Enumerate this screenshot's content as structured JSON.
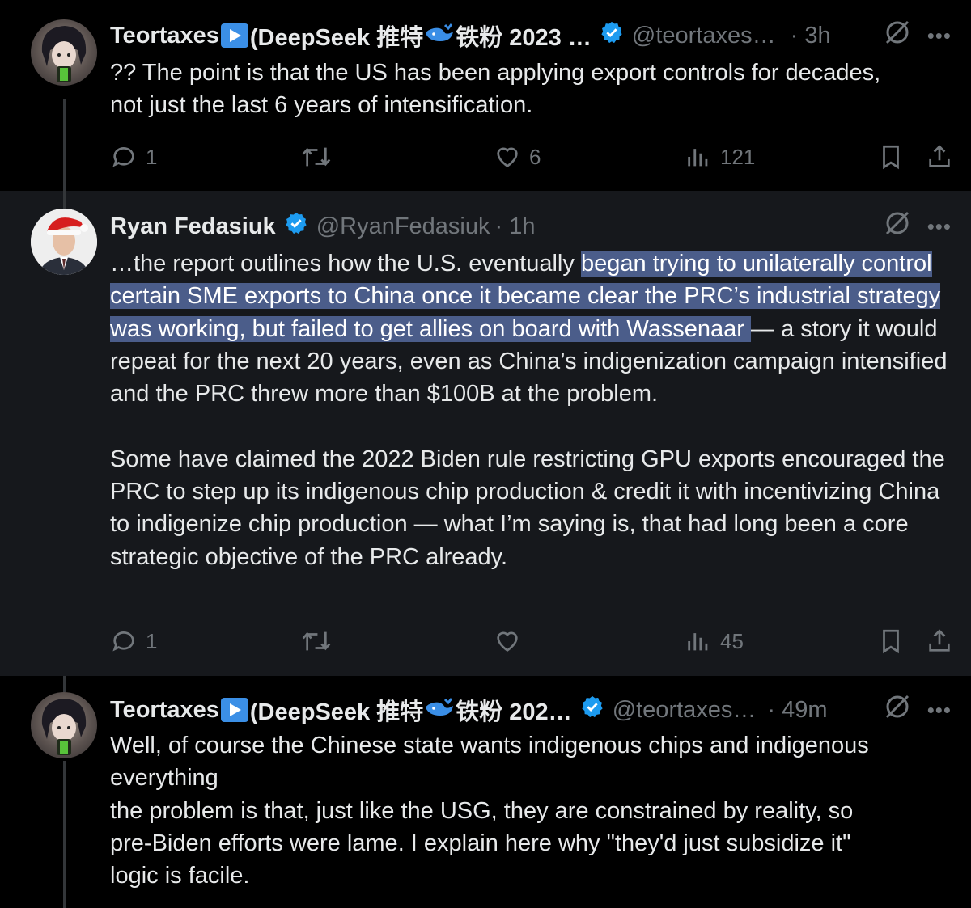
{
  "tweets": [
    {
      "author": "Teortaxes",
      "author_suffix_pre": "(DeepSeek 推特",
      "author_suffix_post": "铁粉 2023 …",
      "handle": "@teortaxes…",
      "time": "· 3h",
      "text_lines": [
        "?? The point is that the US has been applying export controls for decades,",
        "not just the last 6 years of intensification."
      ],
      "actions": {
        "replies": "1",
        "retweets": "",
        "likes": "6",
        "views": "121"
      }
    },
    {
      "author": "Ryan Fedasiuk",
      "handle": "@RyanFedasiuk",
      "time": "· 1h",
      "p1_before": "…the report outlines how the U.S. eventually ",
      "p1_highlight": "began trying to unilaterally control certain SME exports to China once it became clear the PRC’s industrial strategy was working, but failed to get allies on board with Wassenaar ",
      "p1_after": "— a story it would repeat for the next 20 years, even as China’s indigenization campaign intensified and the PRC threw more than $100B at the problem.",
      "p2": "Some have claimed the 2022 Biden rule restricting GPU exports encouraged the PRC to step up its indigenous chip production & credit it with incentivizing China to indigenize chip production — what I’m saying is, that had long been a core strategic objective of the PRC already.",
      "actions": {
        "replies": "1",
        "retweets": "",
        "likes": "",
        "views": "45"
      }
    },
    {
      "author": "Teortaxes",
      "author_suffix_pre": "(DeepSeek 推特",
      "author_suffix_post": "铁粉 202…",
      "handle": "@teortaxes…",
      "time": "· 49m",
      "text_lines": [
        "Well, of course the Chinese state wants indigenous chips and indigenous",
        "everything",
        "the problem is that, just like the USG, they are constrained by reality, so",
        "pre-Biden efforts were lame. I explain here why \"they'd just subsidize it\"",
        "logic is facile."
      ]
    }
  ],
  "colors": {
    "background": "#000000",
    "highlighted_tweet_bg": "#16181c",
    "text": "#e7e9ea",
    "muted": "#71767b",
    "verified": "#1d9bf0",
    "selection": "#4b5d8a"
  },
  "icons": [
    "play-icon",
    "whale-icon",
    "verified-icon",
    "grok-icon",
    "more-icon",
    "reply-icon",
    "retweet-icon",
    "like-icon",
    "views-icon",
    "bookmark-icon",
    "share-icon"
  ]
}
